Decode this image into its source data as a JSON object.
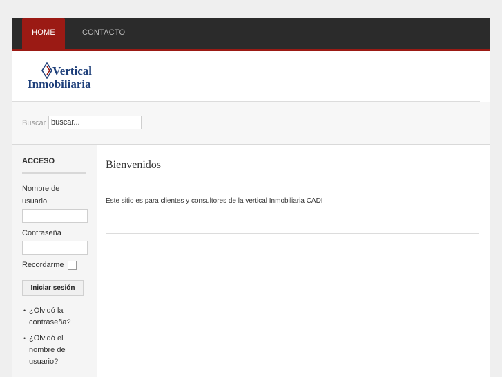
{
  "nav": {
    "items": [
      {
        "label": "HOME",
        "active": true
      },
      {
        "label": "CONTACTO",
        "active": false
      }
    ]
  },
  "logo": {
    "line1": "Vertical",
    "line2": "Inmobiliaria",
    "color": "#1e3f7a"
  },
  "search": {
    "label": "Buscar",
    "value": "buscar..."
  },
  "login": {
    "title": "ACCESO",
    "username_label": "Nombre de usuario",
    "password_label": "Contraseña",
    "remember_label": "Recordarme",
    "submit_label": "Iniciar sesión",
    "links": [
      "¿Olvidó la contraseña?",
      "¿Olvidó el nombre de usuario?"
    ]
  },
  "main": {
    "title": "Bienvenidos",
    "text": "Este sitio es para clientes y consultores de la vertical Inmobiliaria CADI"
  },
  "colors": {
    "accent": "#9b1a14",
    "topbar": "#2b2b2b"
  }
}
